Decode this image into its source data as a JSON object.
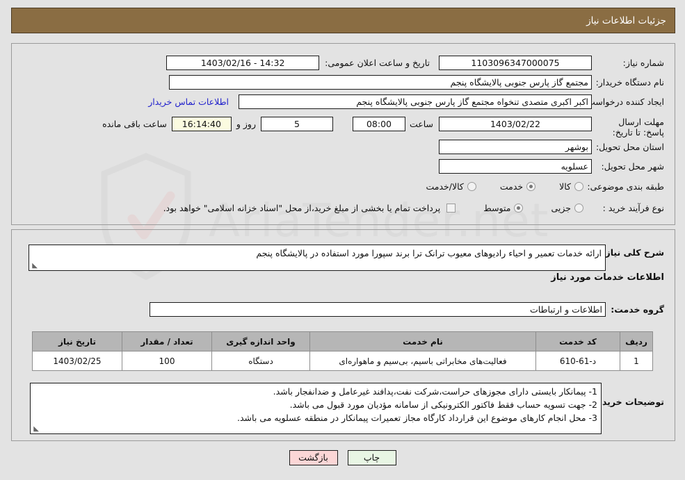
{
  "header": {
    "title": "جزئیات اطلاعات نیاز"
  },
  "watermark": {
    "text": "AriaTender.net"
  },
  "top": {
    "need_number_label": "شماره نیاز:",
    "need_number_value": "1103096347000075",
    "announce_label": "تاریخ و ساعت اعلان عمومی:",
    "announce_value": "14:32 - 1403/02/16",
    "buyer_org_label": "نام دستگاه خریدار:",
    "buyer_org_value": "مجتمع گاز پارس جنوبی  پالایشگاه پنجم",
    "creator_label": "ایجاد کننده درخواست:",
    "creator_value": "اکبر اکبری متصدی تنخواه  مجتمع گاز پارس جنوبی  پالایشگاه پنجم",
    "contact_link": "اطلاعات تماس خریدار",
    "deadline_label": "مهلت ارسال پاسخ: تا تاریخ:",
    "deadline_date": "1403/02/22",
    "time_label": "ساعت",
    "deadline_time": "08:00",
    "days_value": "5",
    "days_label": "روز و",
    "countdown_value": "16:14:40",
    "remaining_label": "ساعت باقی مانده",
    "province_label": "استان محل تحویل:",
    "province_value": "بوشهر",
    "city_label": "شهر محل تحویل:",
    "city_value": "عسلویه",
    "category_label": "طبقه بندی موضوعی:",
    "category_options": [
      {
        "label": "کالا",
        "selected": false
      },
      {
        "label": "خدمت",
        "selected": true
      },
      {
        "label": "کالا/خدمت",
        "selected": false
      }
    ],
    "process_label": "نوع فرآیند خرید :",
    "process_options": [
      {
        "label": "جزیی",
        "selected": false
      },
      {
        "label": "متوسط",
        "selected": true
      }
    ],
    "treasury_checkbox_checked": false,
    "treasury_text": "پرداخت تمام یا بخشی از مبلغ خرید،از محل \"اسناد خزانه اسلامی\" خواهد بود."
  },
  "bottom": {
    "general_desc_label": "شرح کلی نیاز:",
    "general_desc_value": "ارائه خدمات تعمیر و احیاء رادیوهای معیوب ترانک ترا برند سپورا مورد استفاده در پالایشگاه پنجم",
    "services_section_title": "اطلاعات خدمات مورد نیاز",
    "service_group_label": "گروه خدمت:",
    "service_group_value": "اطلاعات و ارتباطات",
    "table": {
      "columns": [
        "ردیف",
        "کد خدمت",
        "نام خدمت",
        "واحد اندازه گیری",
        "تعداد / مقدار",
        "تاریخ نیاز"
      ],
      "rows": [
        {
          "row": "1",
          "code": "د-61-610",
          "name": "فعالیت‌های مخابراتی باسیم، بی‌سیم و ماهواره‌ای",
          "unit": "دستگاه",
          "qty": "100",
          "date": "1403/02/25"
        }
      ]
    },
    "buyer_notes_label": "توضیحات خریدار:",
    "buyer_notes_lines": [
      "1- پیمانکار بایستی دارای مجوزهای حراست،شرکت نفت،پدافند غیرعامل و ضدانفجار باشد.",
      "2- جهت تسویه حساب فقط فاکتور الکترونیکی از سامانه مؤدیان مورد قبول می باشد.",
      "3- محل انجام کارهای موضوع این قرارداد کارگاه مجاز تعمیرات پیمانکار در منطقه عسلویه می باشد."
    ]
  },
  "buttons": {
    "print": "چاپ",
    "back": "بازگشت"
  }
}
